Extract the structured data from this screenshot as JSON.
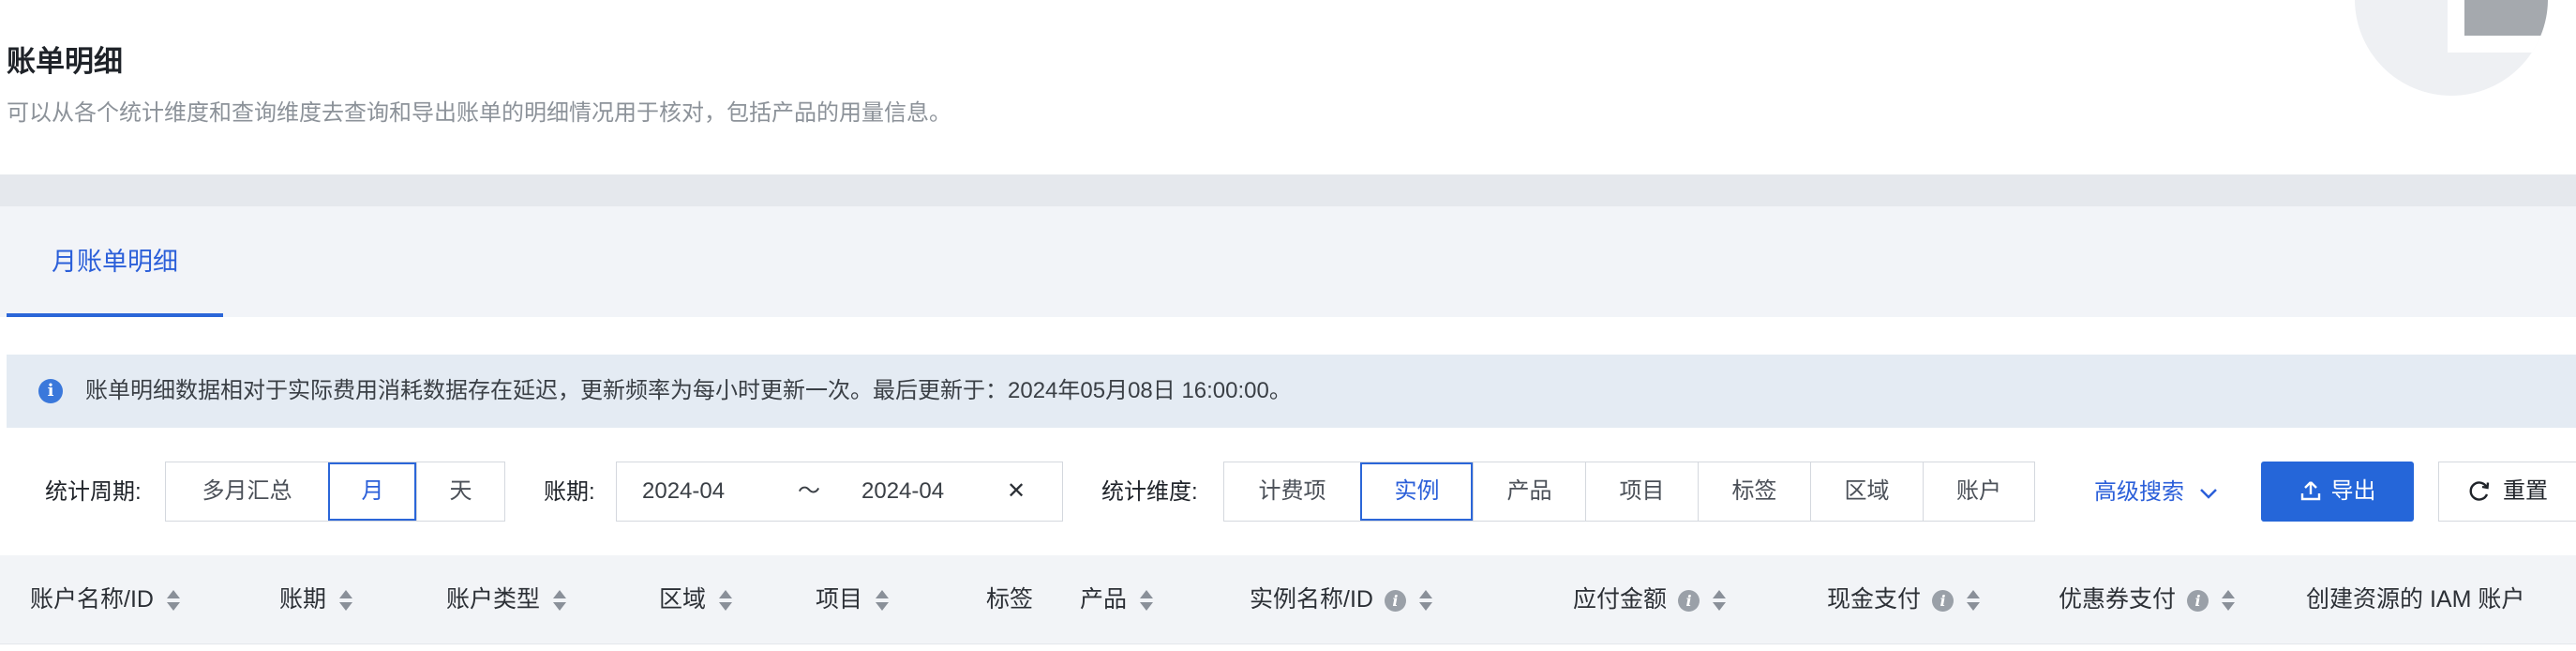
{
  "header": {
    "title": "账单明细",
    "description": "可以从各个统计维度和查询维度去查询和导出账单的明细情况用于核对，包括产品的用量信息。"
  },
  "tabs": [
    {
      "label": "月账单明细",
      "active": true
    }
  ],
  "notice": {
    "icon": "info-icon",
    "text": "账单明细数据相对于实际费用消耗数据存在延迟，更新频率为每小时更新一次。最后更新于：2024年05月08日 16:00:00。"
  },
  "filters": {
    "period_label": "统计周期:",
    "period_options": [
      "多月汇总",
      "月",
      "天"
    ],
    "period_selected": "月",
    "billing_label": "账期:",
    "date_start": "2024-04",
    "date_sep": "～",
    "date_end": "2024-04",
    "clear_glyph": "✕",
    "dimension_label": "统计维度:",
    "dimension_options": [
      "计费项",
      "实例",
      "产品",
      "项目",
      "标签",
      "区域",
      "账户"
    ],
    "dimension_selected": "实例",
    "advanced_search": "高级搜索",
    "export_label": "导出",
    "reset_label": "重置"
  },
  "table": {
    "columns": [
      "账户名称/ID",
      "账期",
      "账户类型",
      "区域",
      "项目",
      "标签",
      "产品",
      "实例名称/ID",
      "应付金额",
      "现金支付",
      "优惠券支付",
      "创建资源的 IAM 账户"
    ]
  },
  "colors": {
    "accent": "#2566d9",
    "notice_bg": "#e4ebf3",
    "table_header_bg": "#f2f4f7"
  }
}
